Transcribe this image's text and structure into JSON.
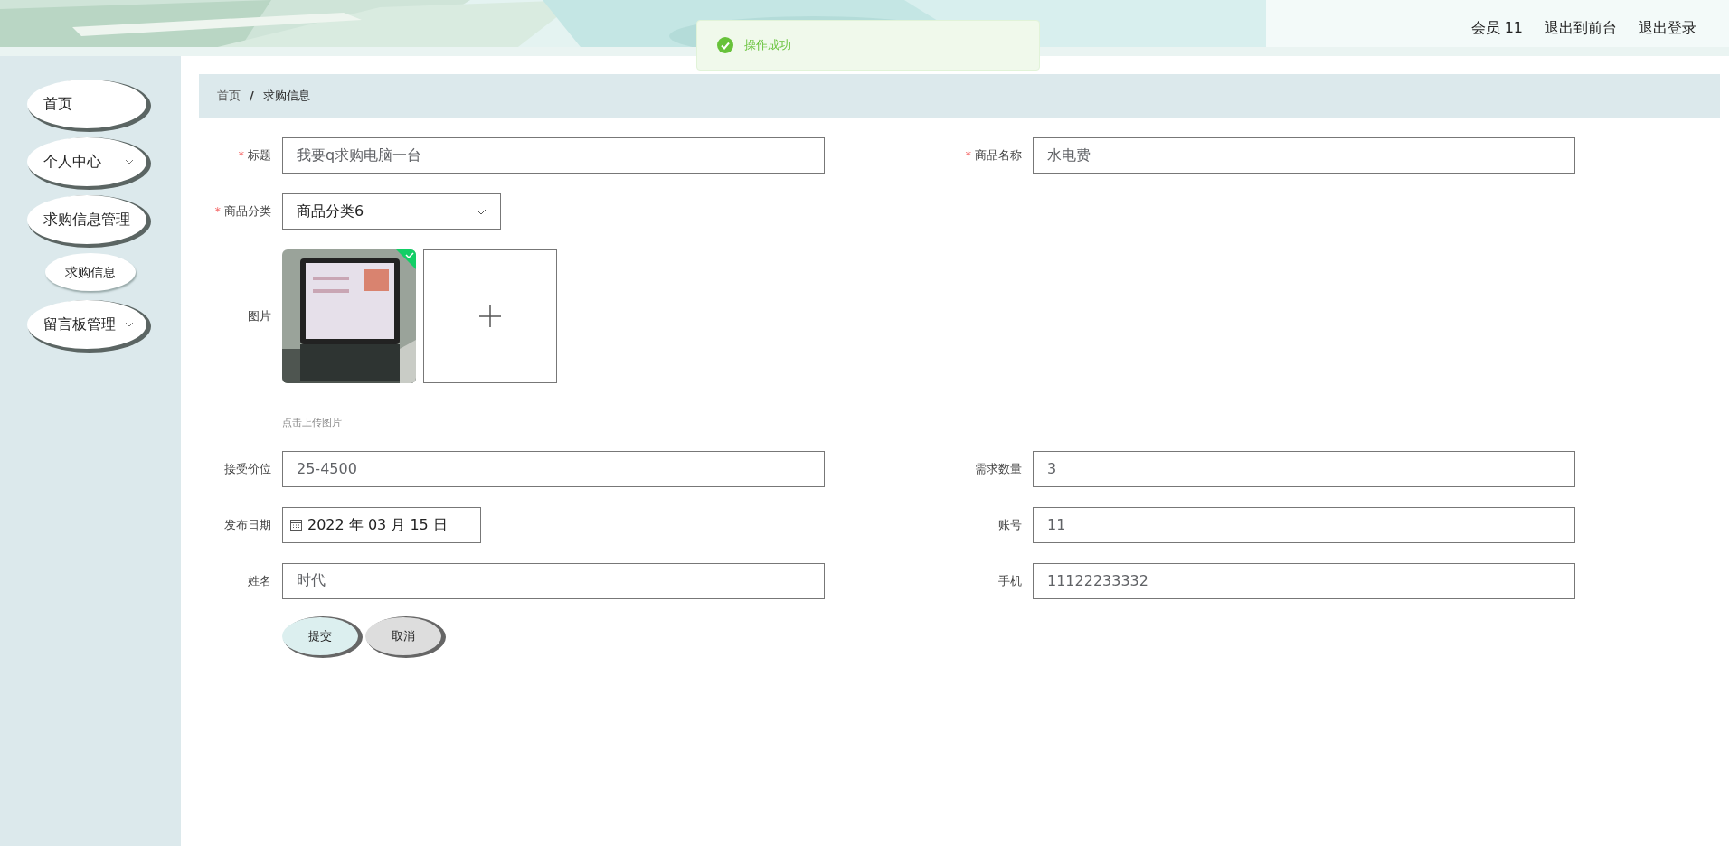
{
  "header": {
    "user_links": [
      "会员 11",
      "退出到前台",
      "退出登录"
    ]
  },
  "toast": {
    "message": "操作成功",
    "kind": "success"
  },
  "sidebar": {
    "items": [
      {
        "label": "首页"
      },
      {
        "label": "个人中心",
        "expanded": false
      },
      {
        "label": "求购信息管理",
        "expanded": true,
        "children": [
          {
            "label": "求购信息"
          }
        ]
      },
      {
        "label": "留言板管理",
        "expanded": false
      }
    ]
  },
  "breadcrumb": [
    "首页",
    "求购信息"
  ],
  "separator": "/",
  "form": {
    "required_mark": "*",
    "rows": [
      [
        {
          "label": "标题",
          "required": true,
          "kind": "text",
          "value": "我要q求购电脑一台"
        },
        {
          "label": "商品名称",
          "required": true,
          "kind": "text",
          "value": "水电费"
        }
      ],
      [
        {
          "label": "商品分类",
          "required": true,
          "kind": "select",
          "value": "商品分类6"
        }
      ],
      [
        {
          "label": "图片",
          "required": false,
          "uploaded": true,
          "hint": "点击上传图片"
        }
      ],
      [
        {
          "label": "接受价位",
          "required": false,
          "kind": "text",
          "value": "25-4500"
        },
        {
          "label": "需求数量",
          "required": false,
          "kind": "text",
          "value": "3"
        }
      ],
      [
        {
          "label": "发布日期",
          "required": false,
          "kind": "date",
          "value": "2022 年 03 月 15 日"
        },
        {
          "label": "账号",
          "required": false,
          "kind": "text",
          "value": "11"
        }
      ],
      [
        {
          "label": "姓名",
          "required": false,
          "kind": "text",
          "value": "时代"
        },
        {
          "label": "手机",
          "required": false,
          "kind": "text",
          "value": "11122233332"
        }
      ]
    ],
    "buttons": [
      {
        "label": "提交",
        "kind": "primary"
      },
      {
        "label": "取消",
        "kind": "secondary"
      }
    ]
  }
}
